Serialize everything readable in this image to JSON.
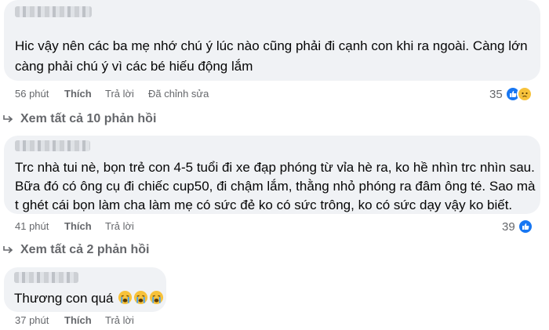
{
  "comments": [
    {
      "text_lines": [
        "Hic vậy nên các ba mẹ nhớ chú ý lúc nào cũng phải đi cạnh con khi ra ngoài. Càng lớn",
        "càng phải chú ý vì các bé hiếu động lắm"
      ],
      "time": "56 phút",
      "like": "Thích",
      "reply": "Trả lời",
      "edited": "Đã chỉnh sửa",
      "reaction_count": "35",
      "reaction_icons": [
        "like-icon",
        "sad-icon"
      ]
    },
    {
      "text_lines": [
        "Trc nhà tui nè, bọn trẻ con 4-5 tuổi đi xe đạp phóng từ vỉa hè ra, ko hề nhìn trc nhìn sau.",
        "Bữa đó có ông cụ đi chiếc cup50, đi chậm lắm, thằng nhỏ phóng ra đâm ông té. Sao mà",
        "t ghét cái bọn làm cha làm mẹ có sức đẻ ko có sức trông, ko có sức dạy vậy ko biết."
      ],
      "time": "41 phút",
      "like": "Thích",
      "reply": "Trả lời",
      "reaction_count": "39",
      "reaction_icons": [
        "like-icon"
      ]
    },
    {
      "text": "Thương con quá",
      "emojis": [
        "crying-face-icon",
        "crying-face-icon",
        "crying-face-icon"
      ],
      "time": "37 phút",
      "like": "Thích",
      "reply": "Trả lời"
    }
  ],
  "view_replies": [
    "Xem tất cả 10 phản hồi",
    "Xem tất cả 2 phản hồi"
  ],
  "colors": {
    "bubble": "#f0f2f5",
    "meta": "#65676b",
    "like": "#1877f2",
    "sad": "#f7c23b"
  }
}
